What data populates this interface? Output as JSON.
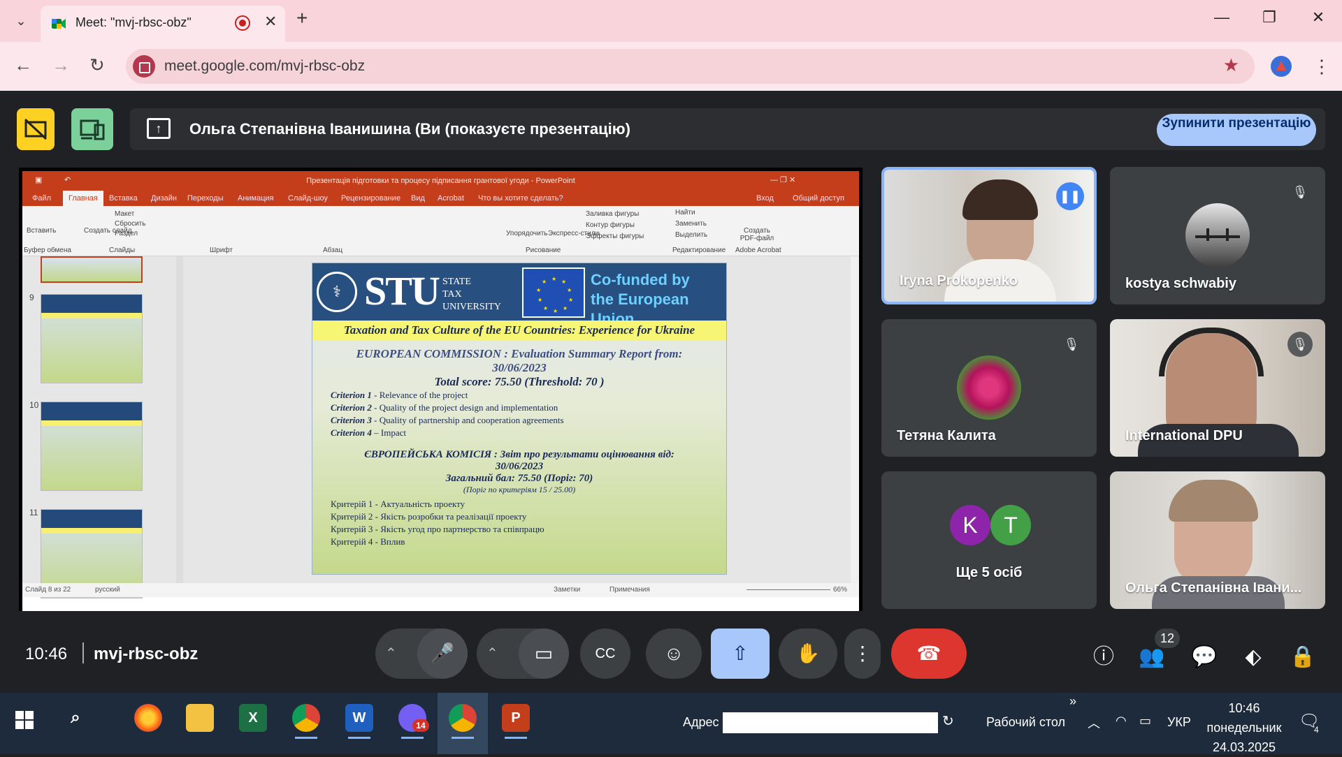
{
  "browser": {
    "tab_title": "Meet: \"mvj-rbsc-obz\"",
    "url": "meet.google.com/mvj-rbsc-obz"
  },
  "meet": {
    "presenting_text": "Ольга Степанівна Іванишина (Ви (показуєте презентацію)",
    "stop_button": "Зупинити презентацію",
    "meeting_code": "mvj-rbsc-obz",
    "time": "10:46",
    "participant_count": "12",
    "participants": [
      {
        "name": "Iryna Prokopenko",
        "state": "speaking"
      },
      {
        "name": "kostya schwabiy",
        "state": "muted"
      },
      {
        "name": "Тетяна Калита",
        "state": "muted"
      },
      {
        "name": "International DPU",
        "state": "muted"
      },
      {
        "name": "Ще 5 осіб",
        "avatars": [
          "K",
          "T"
        ]
      },
      {
        "name": "Ольга Степанівна Івани...",
        "state": ""
      }
    ]
  },
  "powerpoint": {
    "title": "Презентація підготовки та процесу підписання грантової угоди - PowerPoint",
    "tabs": [
      "Файл",
      "Главная",
      "Вставка",
      "Дизайн",
      "Переходы",
      "Анимация",
      "Слайд-шоу",
      "Рецензирование",
      "Вид",
      "Acrobat",
      "Что вы хотите сделать?"
    ],
    "account": [
      "Вход",
      "Общий доступ"
    ],
    "ribbon": {
      "paste": "Вставить",
      "new_slide": "Создать слайд",
      "layout": "Макет",
      "reset": "Сбросить",
      "section": "Раздел",
      "clipboard": "Буфер обмена",
      "slides": "Слайды",
      "font": "Шрифт",
      "paragraph": "Абзац",
      "arrange": "Упорядочить",
      "quick_styles": "Экспресс-стили",
      "shape_fill": "Заливка фигуры",
      "shape_outline": "Контур фигуры",
      "shape_effects": "Эффекты фигуры",
      "drawing": "Рисование",
      "find": "Найти",
      "replace": "Заменить",
      "select": "Выделить",
      "editing": "Редактирование",
      "create_pdf": "Создать PDF-файл",
      "adobe": "Adobe Acrobat"
    },
    "thumb_numbers": [
      "9",
      "10",
      "11"
    ],
    "status_left": "Слайд 8 из 22",
    "language": "русский",
    "notes": "Заметки",
    "comments": "Примечания",
    "zoom": "66%"
  },
  "slide": {
    "stu_big": "STU",
    "stu_small": [
      "STATE",
      "TAX",
      "UNIVERSITY"
    ],
    "cofunded": [
      "Co-funded by",
      "the European Union"
    ],
    "band": "Taxation and Tax Culture of the EU Countries: Experience for Ukraine",
    "en_heading_1": "EUROPEAN COMMISSION : Evaluation Summary Report from:",
    "en_heading_2": "30/06/2023",
    "en_score": "Total score: 75.50 (Threshold: 70 )",
    "en_criteria": [
      {
        "label": "Criterion 1",
        "text": " - Relevance of the project"
      },
      {
        "label": "Criterion 2",
        "text": " - Quality of the project design and implementation"
      },
      {
        "label": "Criterion 3",
        "text": " - Quality of partnership and cooperation agreements"
      },
      {
        "label": "Criterion 4",
        "text": " – Impact"
      }
    ],
    "ua_heading_1": "ЄВРОПЕЙСЬКА КОМІСІЯ : Звіт про результати оцінювання від:",
    "ua_heading_2": "30/06/2023",
    "ua_score": "Загальний бал: 75.50 (Поріг: 70)",
    "ua_threshold": "(Поріг по критеріям 15 / 25.00)",
    "ua_criteria": [
      "Критерій 1 - Актуальність проекту",
      "Критерій 2 - Якість розробки та реалізації проекту",
      "Критерій 3 - Якість угод про партнерство та співпрацю",
      "Критерій 4 - Вплив"
    ]
  },
  "taskbar": {
    "address_label": "Адрес",
    "desktop_label": "Рабочий стол",
    "language": "УКР",
    "time": "10:46",
    "day": "понедельник",
    "date": "24.03.2025",
    "notifications": "4",
    "viber_badge": "14"
  }
}
